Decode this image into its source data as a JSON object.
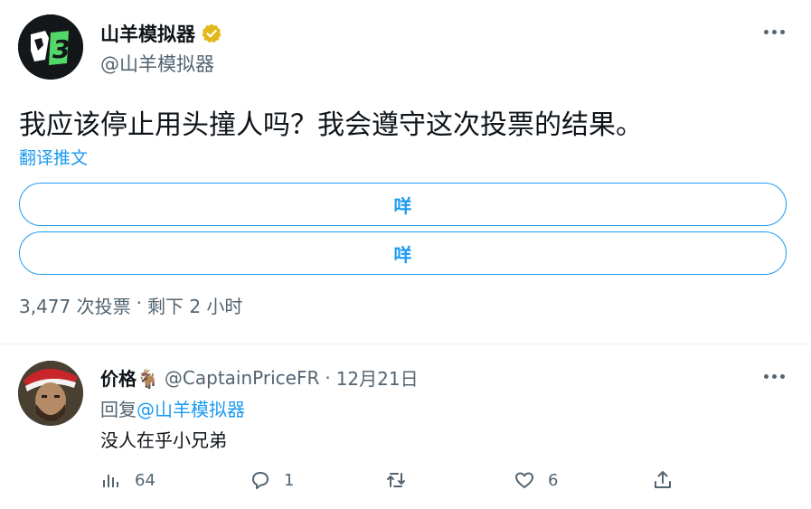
{
  "tweet": {
    "author_name": "山羊模拟器",
    "handle": "@山羊模拟器",
    "text": "我应该停止用头撞人吗？我会遵守这次投票的结果。",
    "translate_label": "翻译推文",
    "poll": {
      "options": [
        "咩",
        "咩"
      ],
      "votes": "3,477 次投票",
      "separator": "·",
      "remaining": "剩下 2 小时"
    }
  },
  "reply": {
    "author_name": "价格🐐",
    "handle": "@CaptainPriceFR",
    "separator": "·",
    "date": "12月21日",
    "reply_prefix": "回复",
    "reply_mention": "@山羊模拟器",
    "text": "没人在乎小兄弟",
    "actions": {
      "views": "64",
      "replies": "1",
      "retweets": "",
      "likes": "6"
    }
  },
  "colors": {
    "accent": "#1d9bf0",
    "verified": "#e2b719",
    "text_secondary": "#536471",
    "logo_green": "#53d769"
  },
  "icons": [
    "verified-badge-icon",
    "more-icon",
    "views-icon",
    "reply-icon",
    "retweet-icon",
    "like-icon",
    "share-icon"
  ]
}
